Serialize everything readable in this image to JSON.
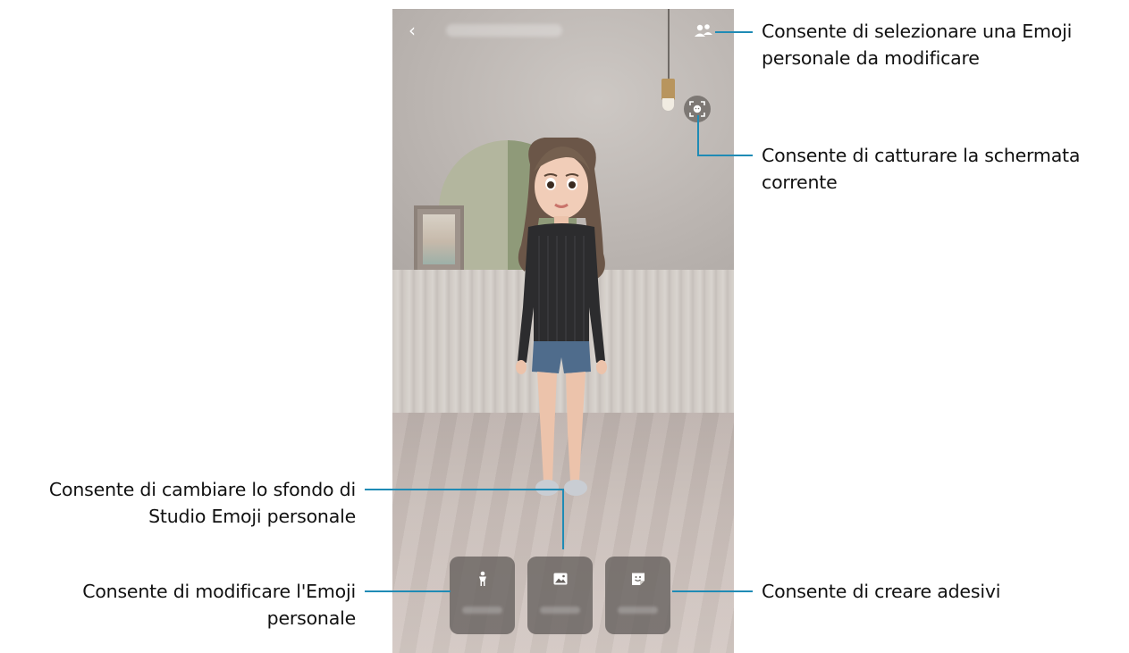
{
  "callouts": {
    "select_emoji": "Consente di selezionare una Emoji personale da modificare",
    "select_emoji_line1": "Consente di selezionare una Emoji",
    "select_emoji_line2": "personale da modificare",
    "capture_screen_line1": "Consente di catturare la schermata",
    "capture_screen_line2": "corrente",
    "change_background_line1": "Consente di cambiare lo sfondo di",
    "change_background_line2": "Studio Emoji personale",
    "edit_emoji_line1": "Consente di modificare l'Emoji",
    "edit_emoji_line2": "personale",
    "create_stickers": "Consente di creare adesivi"
  },
  "phone": {
    "back_glyph": "‹"
  },
  "icons": {
    "back": "chevron-left-icon",
    "select_emoji": "people-icon",
    "capture": "face-capture-icon",
    "edit_body": "person-icon",
    "background": "image-icon",
    "stickers": "sticker-icon"
  },
  "colors": {
    "callout_line": "#1f8bb5",
    "button_bg": "#645f5c"
  }
}
